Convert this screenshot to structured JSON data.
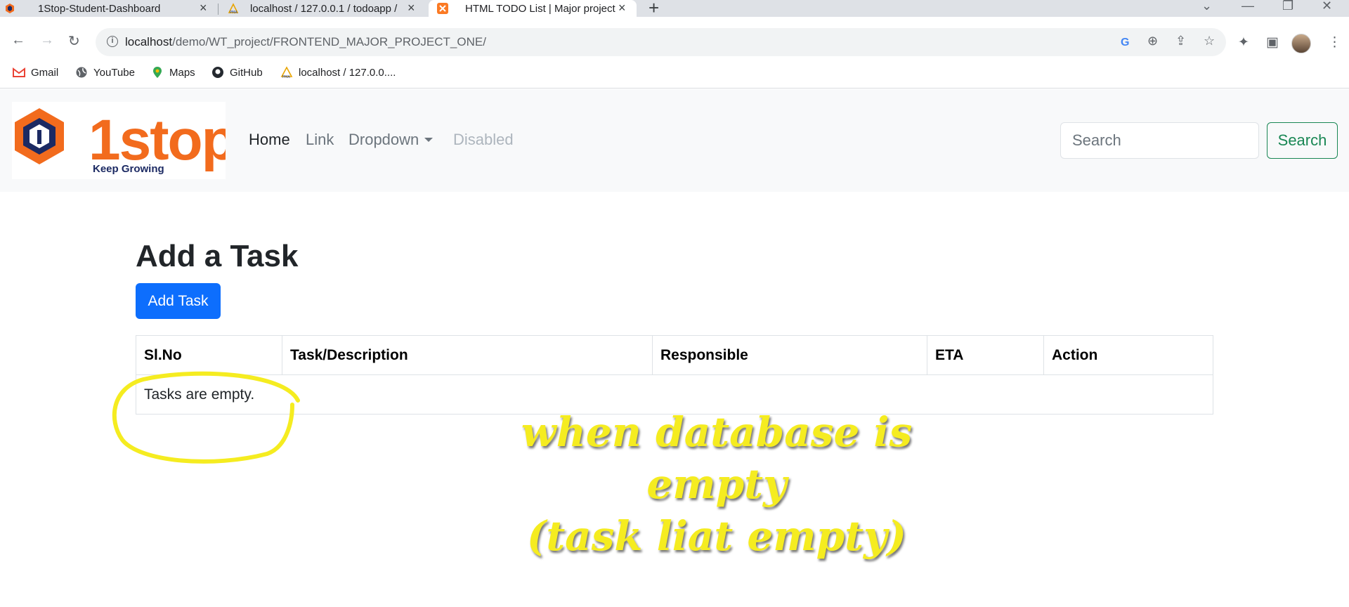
{
  "browser": {
    "tabs": [
      {
        "title": "1Stop-Student-Dashboard",
        "active": false
      },
      {
        "title": "localhost / 127.0.0.1 / todoapp / ",
        "active": false
      },
      {
        "title": "HTML TODO List | Major project",
        "active": true
      }
    ],
    "url_host": "localhost",
    "url_path": "/demo/WT_project/FRONTEND_MAJOR_PROJECT_ONE/",
    "bookmarks": [
      "Gmail",
      "YouTube",
      "Maps",
      "GitHub",
      "localhost / 127.0.0...."
    ]
  },
  "navbar": {
    "logo_text": "1stop",
    "logo_tagline": "Keep Growing",
    "links": {
      "home": "Home",
      "link": "Link",
      "dropdown": "Dropdown",
      "disabled": "Disabled"
    },
    "search_placeholder": "Search",
    "search_button": "Search"
  },
  "main": {
    "heading": "Add a Task",
    "add_button": "Add Task",
    "table": {
      "headers": [
        "Sl.No",
        "Task/Description",
        "Responsible",
        "ETA",
        "Action"
      ],
      "empty_message": "Tasks are empty."
    }
  },
  "annotation": {
    "line1": "when database is empty",
    "line2": "(task liat empty)",
    "color": "#f5ec20"
  },
  "colors": {
    "primary": "#0d6efd",
    "success": "#198754",
    "navbar_bg": "#f8f9fa",
    "logo_orange": "#f26b1d",
    "logo_navy": "#1c2a63"
  }
}
